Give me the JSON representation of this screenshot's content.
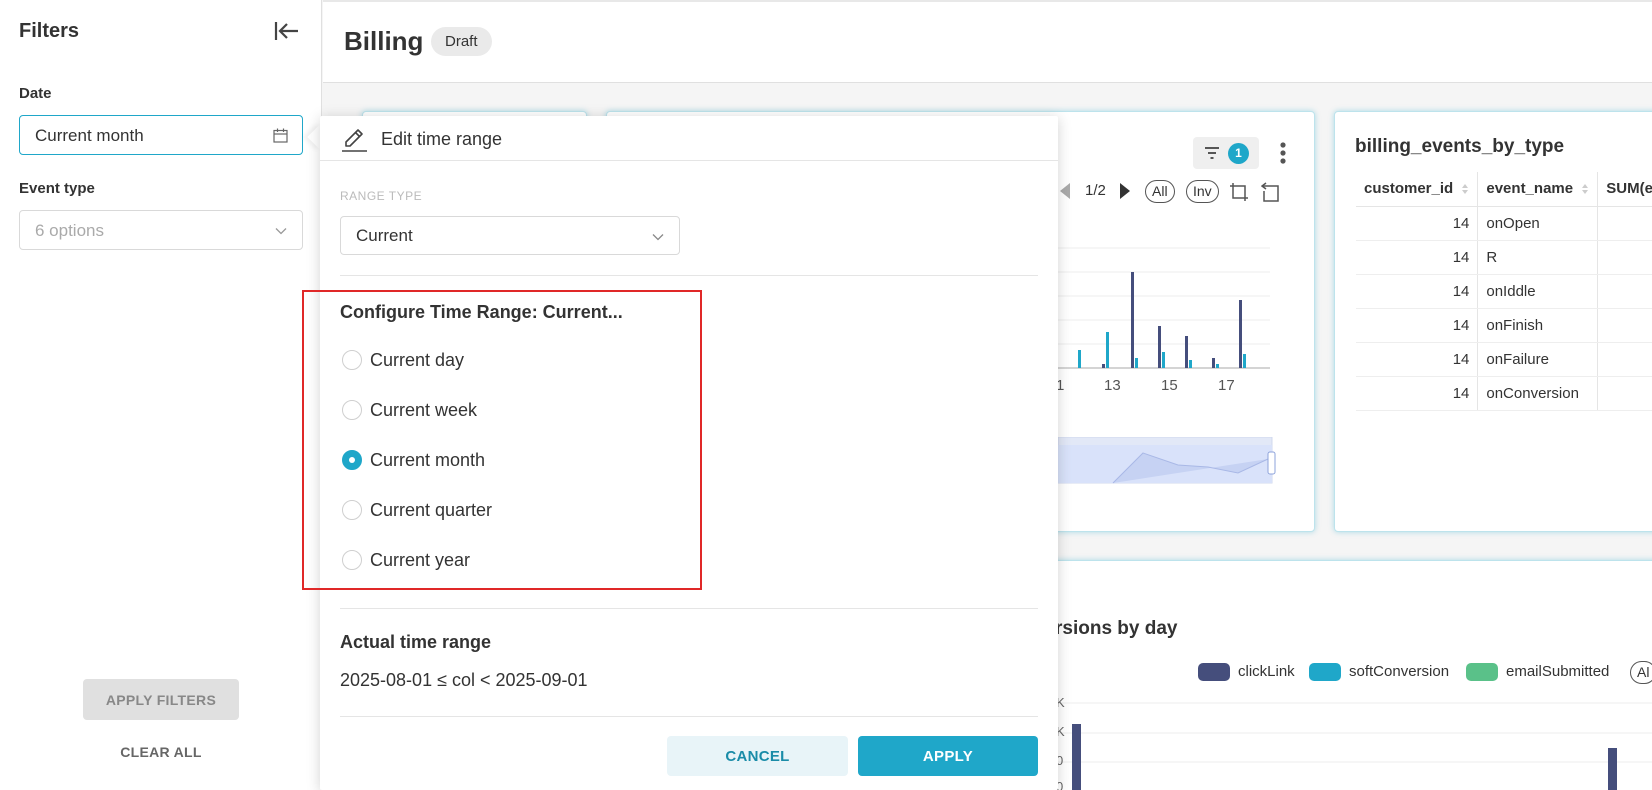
{
  "sidebar": {
    "title": "Filters",
    "date_label": "Date",
    "date_value": "Current month",
    "event_type_label": "Event type",
    "event_type_placeholder": "6 options",
    "apply_filters": "APPLY FILTERS",
    "clear_all": "CLEAR ALL"
  },
  "header": {
    "title": "Billing",
    "badge": "Draft"
  },
  "chart_card": {
    "filter_count": "1",
    "page_indicator": "1/2",
    "pill_all": "All",
    "pill_inv": "Inv",
    "x_ticks": [
      "1",
      "13",
      "15",
      "17"
    ]
  },
  "table_card": {
    "title": "billing_events_by_type",
    "columns": [
      "customer_id",
      "event_name",
      "SUM(ev"
    ],
    "rows": [
      {
        "customer_id": "14",
        "event_name": "onOpen"
      },
      {
        "customer_id": "14",
        "event_name": "R"
      },
      {
        "customer_id": "14",
        "event_name": "onIddle"
      },
      {
        "customer_id": "14",
        "event_name": "onFinish"
      },
      {
        "customer_id": "14",
        "event_name": "onFailure"
      },
      {
        "customer_id": "14",
        "event_name": "onConversion"
      }
    ]
  },
  "bottom_chart": {
    "title_fragment": "rsions by day",
    "legend": [
      {
        "name": "clickLink",
        "color": "#454e7c"
      },
      {
        "name": "softConversion",
        "color": "#1fa7c9"
      },
      {
        "name": "emailSubmitted",
        "color": "#5ac189"
      }
    ],
    "legend_all": "Al",
    "y_fragments": [
      "K",
      "K",
      "0",
      "0"
    ]
  },
  "popover": {
    "title": "Edit time range",
    "range_type_label": "RANGE TYPE",
    "range_type_value": "Current",
    "config_title": "Configure Time Range: Current...",
    "options": [
      {
        "label": "Current day",
        "checked": false
      },
      {
        "label": "Current week",
        "checked": false
      },
      {
        "label": "Current month",
        "checked": true
      },
      {
        "label": "Current quarter",
        "checked": false
      },
      {
        "label": "Current year",
        "checked": false
      }
    ],
    "actual_title": "Actual time range",
    "actual_value": "2025-08-01 ≤ col < 2025-09-01",
    "cancel": "CANCEL",
    "apply": "APPLY"
  },
  "colors": {
    "accent": "#1fa7c9",
    "highlight": "#e02828",
    "bar_dark": "#454e7c",
    "bar_light": "#1fa7c9"
  }
}
